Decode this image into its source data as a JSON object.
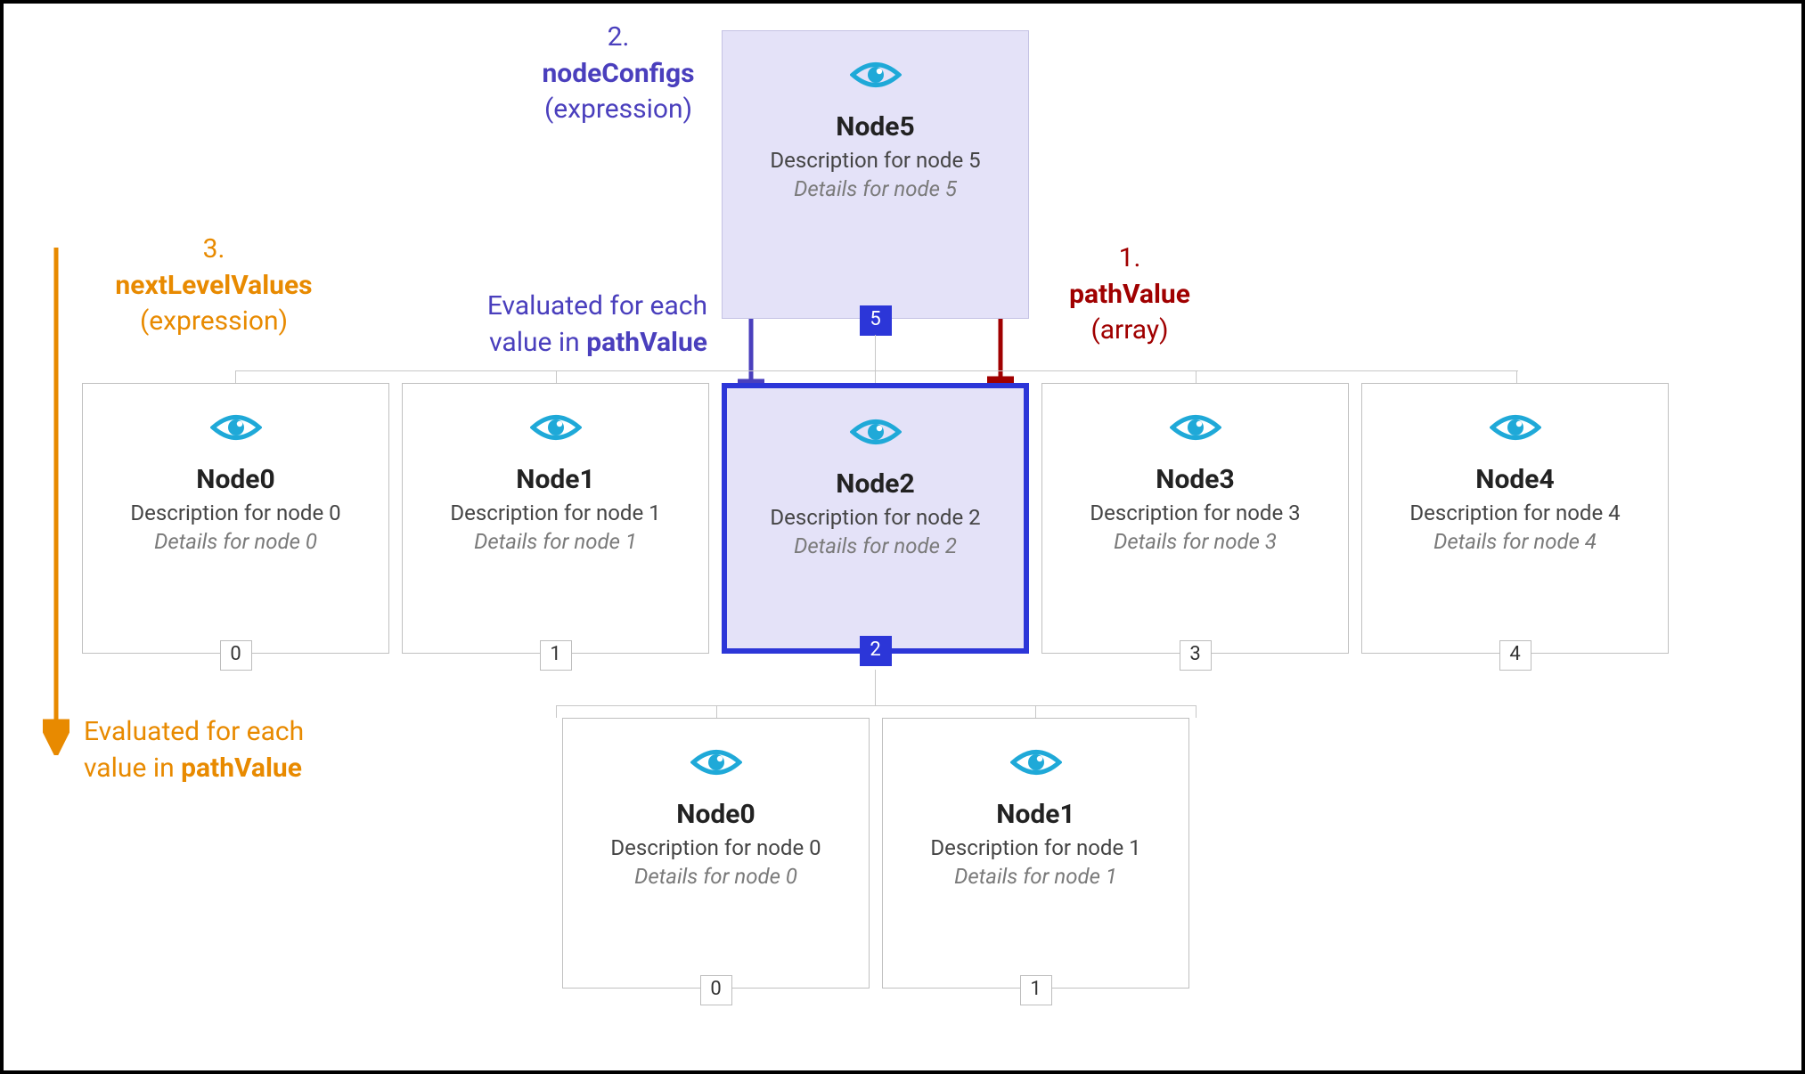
{
  "annotations": {
    "pathValue": {
      "num": "1.",
      "key": "pathValue",
      "paren": "(array)"
    },
    "nodeConfigs": {
      "num": "2.",
      "key": "nodeConfigs",
      "paren": "(expression)",
      "note_line1": "Evaluated for each",
      "note_line2a": "value in ",
      "note_line2b": "pathValue"
    },
    "nextLevelValues": {
      "num": "3.",
      "key": "nextLevelValues",
      "paren": "(expression)",
      "note_line1": "Evaluated for each",
      "note_line2a": "value in ",
      "note_line2b": "pathValue"
    }
  },
  "level0": {
    "title": "Node5",
    "desc": "Description for node 5",
    "details": "Details for node 5",
    "index": "5"
  },
  "level1": [
    {
      "title": "Node0",
      "desc": "Description for node 0",
      "details": "Details for node 0",
      "index": "0"
    },
    {
      "title": "Node1",
      "desc": "Description for node 1",
      "details": "Details for node 1",
      "index": "1"
    },
    {
      "title": "Node2",
      "desc": "Description for node 2",
      "details": "Details for node 2",
      "index": "2"
    },
    {
      "title": "Node3",
      "desc": "Description for node 3",
      "details": "Details for node 3",
      "index": "3"
    },
    {
      "title": "Node4",
      "desc": "Description for node 4",
      "details": "Details for node 4",
      "index": "4"
    }
  ],
  "level2": [
    {
      "title": "Node0",
      "desc": "Description for node 0",
      "details": "Details for node 0",
      "index": "0"
    },
    {
      "title": "Node1",
      "desc": "Description for node 1",
      "details": "Details for node 1",
      "index": "1"
    }
  ]
}
